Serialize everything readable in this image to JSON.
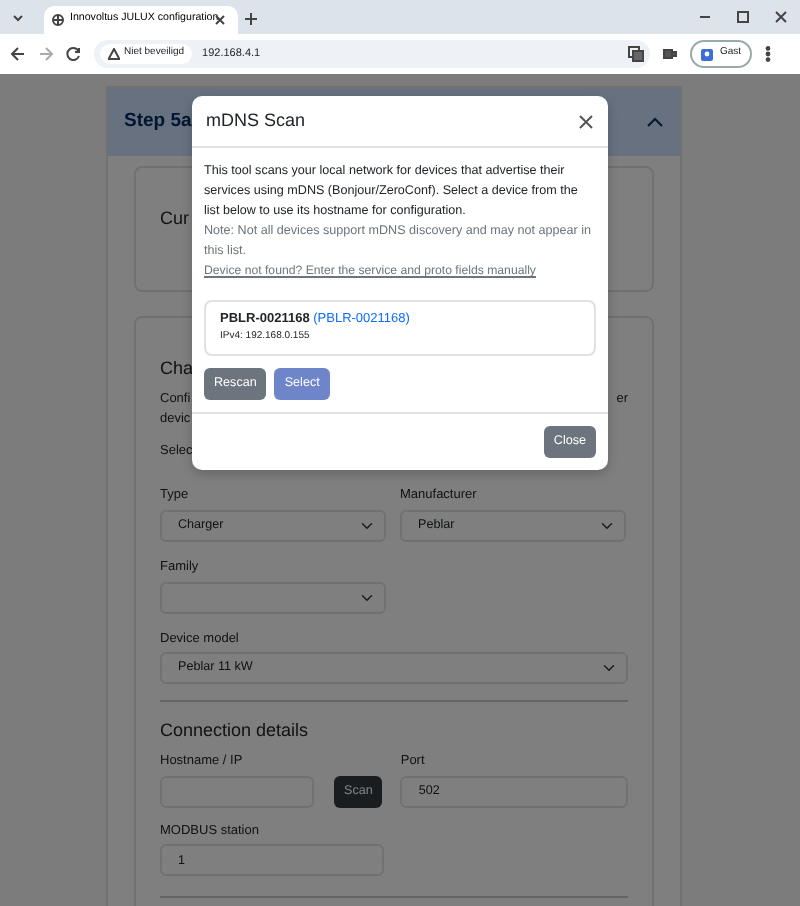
{
  "browser": {
    "tab_title": "Innovoltus JULUX configuration",
    "security_label": "Niet beveiligd",
    "url": "192.168.4.1",
    "profile": "Gast"
  },
  "page": {
    "step_title": "Step 5a",
    "current_card": {
      "title": "Cur"
    },
    "charger_card": {
      "title": "Cha",
      "description_left": [
        "Confi",
        "devic"
      ],
      "description_right": "er",
      "select_label": "Selec",
      "fields": [
        {
          "label": "Type",
          "value": "Charger",
          "kind": "half"
        },
        {
          "label": "Manufacturer",
          "value": "Peblar",
          "kind": "half"
        },
        {
          "label": "Family",
          "kind": "half"
        },
        {
          "label": "Device model",
          "value": "Peblar 11 kW",
          "kind": "full"
        }
      ],
      "connection": {
        "heading": "Connection details",
        "hostname_label": "Hostname / IP",
        "scan_button": "Scan",
        "port_label": "Port",
        "port_value": "502",
        "modbus_label": "MODBUS station",
        "modbus_value": "1"
      }
    }
  },
  "modal": {
    "title": "mDNS Scan",
    "description": "This tool scans your local network for devices that advertise their services using mDNS (Bonjour/ZeroConf). Select a device from the list below to use its hostname for configuration.",
    "note": "Note: Not all devices support mDNS discovery and may not appear in this list.",
    "manual_link": "Device not found? Enter the service and proto fields manually",
    "devices": [
      {
        "name": "PBLR-0021168",
        "hostname": "(PBLR-0021168)",
        "address": "IPv4: 192.168.0.155"
      }
    ],
    "buttons": [
      {
        "label": "Rescan",
        "kind": "secondary",
        "disabled": false
      },
      {
        "label": "Select",
        "kind": "primary",
        "disabled": true
      }
    ],
    "close_button": "Close"
  }
}
